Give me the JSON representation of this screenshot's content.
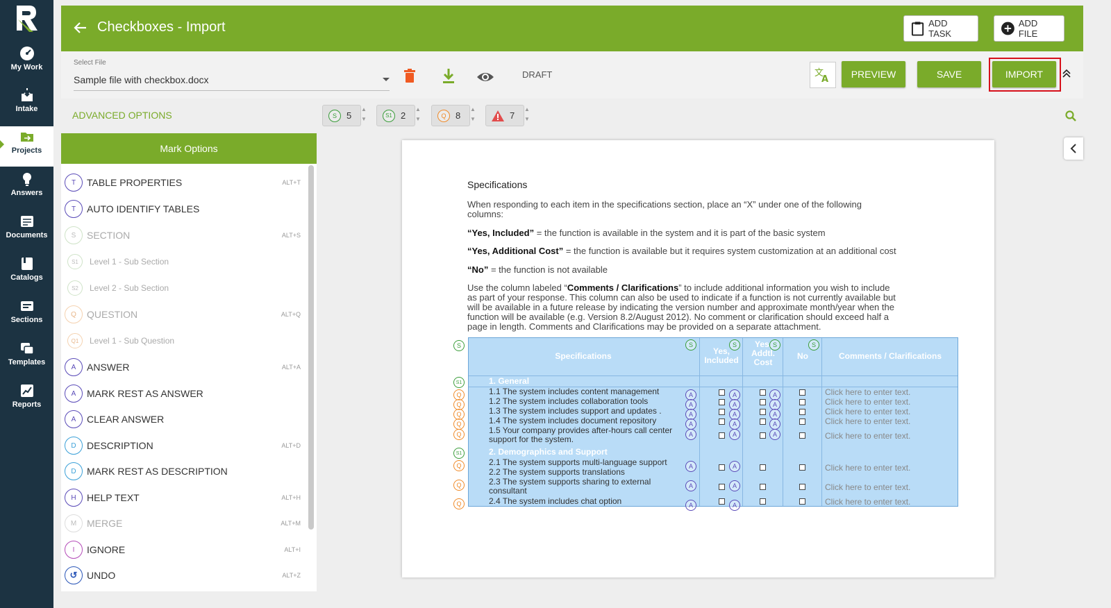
{
  "nav": {
    "items": [
      {
        "label": "My Work",
        "icon": "dashboard-icon"
      },
      {
        "label": "Intake",
        "icon": "intake-icon"
      },
      {
        "label": "Projects",
        "icon": "projects-icon"
      },
      {
        "label": "Answers",
        "icon": "lightbulb-icon"
      },
      {
        "label": "Documents",
        "icon": "documents-icon"
      },
      {
        "label": "Catalogs",
        "icon": "catalogs-icon"
      },
      {
        "label": "Sections",
        "icon": "sections-icon"
      },
      {
        "label": "Templates",
        "icon": "templates-icon"
      },
      {
        "label": "Reports",
        "icon": "reports-icon"
      }
    ],
    "active": "Projects"
  },
  "header": {
    "title": "Checkboxes - Import",
    "add_task": "ADD TASK",
    "add_file": "ADD FILE"
  },
  "filebar": {
    "select_label": "Select File",
    "select_value": "Sample file with checkbox.docx",
    "status": "DRAFT",
    "preview": "PREVIEW",
    "save": "SAVE",
    "import": "IMPORT"
  },
  "options": {
    "advanced": "ADVANCED OPTIONS",
    "counters": [
      {
        "badge": "S",
        "value": "5",
        "color": "#3a9d3a"
      },
      {
        "badge": "S1",
        "value": "2",
        "color": "#3a9d3a"
      },
      {
        "badge": "Q",
        "value": "8",
        "color": "#f08a28"
      },
      {
        "badge": "!",
        "value": "7",
        "color": "#e24c4c"
      }
    ]
  },
  "mark_options": {
    "title": "Mark Options",
    "items": [
      {
        "badge": "T",
        "label": "TABLE PROPERTIES",
        "shortcut": "ALT+T"
      },
      {
        "badge": "T",
        "label": "AUTO IDENTIFY TABLES",
        "shortcut": ""
      },
      {
        "badge": "S",
        "label": "SECTION",
        "shortcut": "ALT+S"
      },
      {
        "badge": "S1",
        "label": "Level 1 - Sub Section",
        "shortcut": ""
      },
      {
        "badge": "S2",
        "label": "Level 2 - Sub Section",
        "shortcut": ""
      },
      {
        "badge": "Q",
        "label": "QUESTION",
        "shortcut": "ALT+Q"
      },
      {
        "badge": "Q1",
        "label": "Level 1 - Sub Question",
        "shortcut": ""
      },
      {
        "badge": "A",
        "label": "ANSWER",
        "shortcut": "ALT+A"
      },
      {
        "badge": "A",
        "label": "MARK REST AS ANSWER",
        "shortcut": ""
      },
      {
        "badge": "A",
        "label": "CLEAR ANSWER",
        "shortcut": ""
      },
      {
        "badge": "D",
        "label": "DESCRIPTION",
        "shortcut": "ALT+D"
      },
      {
        "badge": "D",
        "label": "MARK REST AS DESCRIPTION",
        "shortcut": ""
      },
      {
        "badge": "H",
        "label": "HELP TEXT",
        "shortcut": "ALT+H"
      },
      {
        "badge": "M",
        "label": "MERGE",
        "shortcut": "ALT+M"
      },
      {
        "badge": "I",
        "label": "IGNORE",
        "shortcut": "ALT+I"
      },
      {
        "badge": "↺",
        "label": "UNDO",
        "shortcut": "ALT+Z"
      }
    ]
  },
  "document": {
    "heading": "Specifications",
    "intro": "When responding to each item in the specifications section, place an “X” under one of the following columns:",
    "def1_term": "“Yes, Included”",
    "def1_text": " = the function is available in the system and it is part of the basic system",
    "def2_term": "“Yes, Additional Cost”",
    "def2_text": " = the function is available but it requires system customization at an additional cost",
    "def3_term": "“No”",
    "def3_text": " = the function is not available",
    "comments_pre": "Use the column labeled “",
    "comments_term": "Comments / Clarifications",
    "comments_post": "” to include additional information you wish to include as part of your response. This column can also be used to indicate if a function is not currently available but will be available in a future release by indicating the version number and approximate month/year when the function will be available (e.g. Version 8.2/August 2012). No comment or clarification should exceed half a page in length. Comments and Clarifications may be provided on a separate attachment.",
    "table": {
      "headers": [
        "Specifications",
        "Yes, Included",
        "Yes, Addtl. Cost",
        "No",
        "Comments / Clarifications"
      ],
      "sections": [
        {
          "title": "1.  General",
          "rows": [
            "1.1  The system includes content management",
            "1.2  The system includes collaboration tools",
            "1.3  The system includes support and updates .",
            "1.4  The system includes document repository",
            "1.5  Your company provides after-hours call center support for the system."
          ]
        },
        {
          "title": "2.  Demographics and Support",
          "rows": [
            "2.1  The system supports multi-language support",
            "2.2  The system supports translations",
            "2.3  The system supports sharing to external consultant",
            "2.4  The system includes chat option"
          ]
        }
      ],
      "comment_placeholder": "Click here to enter text."
    }
  }
}
